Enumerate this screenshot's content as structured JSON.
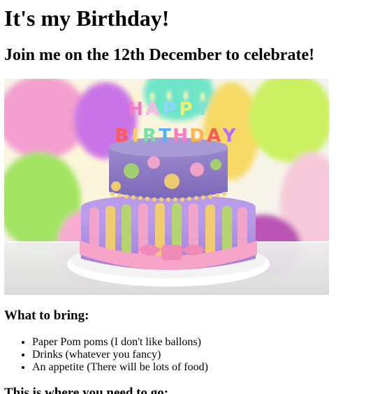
{
  "page": {
    "title": "It's my Birthday!",
    "subtitle": "Join me on the 12th December to celebrate!",
    "hero_image": {
      "candle_letters": [
        "H",
        "A",
        "P",
        "P",
        "Y",
        "B",
        "I",
        "R",
        "T",
        "H",
        "D",
        "A",
        "Y"
      ],
      "colors": {
        "cake_top": "#9b88cc",
        "cake_bottom": "#b79be6",
        "ribbon": "#f4a3c6",
        "plate": "#f2f2f2"
      }
    },
    "bring": {
      "heading": "What to bring:",
      "items": [
        "Paper Pom poms (I don't like ballons)",
        "Drinks (whatever you fancy)",
        "An appetite (There will be lots of food)"
      ]
    },
    "directions": {
      "heading": "This is where you need to go:"
    }
  }
}
